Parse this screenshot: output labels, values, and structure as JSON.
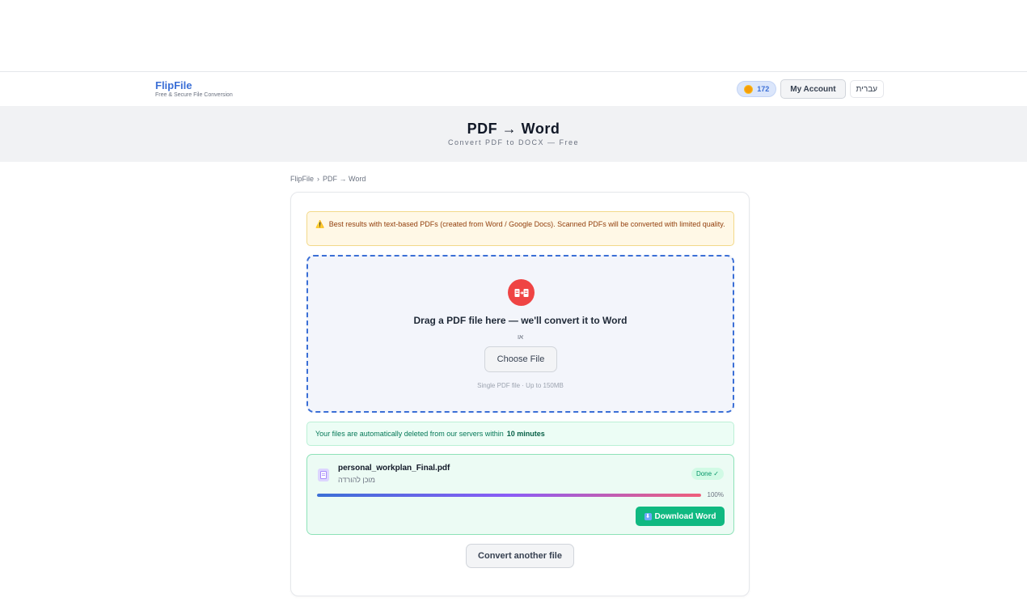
{
  "header": {
    "brand_name": "FlipFile",
    "brand_tagline": "Free & Secure File Conversion",
    "coins": "172",
    "account_label": "My Account",
    "language_label": "עברית"
  },
  "hero": {
    "title": "PDF → Word",
    "subtitle": "Convert PDF to DOCX — Free"
  },
  "breadcrumb": {
    "home": "FlipFile",
    "separator": "›",
    "current": "PDF → Word"
  },
  "notice": {
    "icon": "⚠️",
    "text": "Best results with text-based PDFs (created from Word / Google Docs). Scanned PDFs will be converted with limited quality."
  },
  "dropzone": {
    "icon": "pdf-to-word-icon",
    "title": "Drag a PDF file here — we'll convert it to Word",
    "or_text": "או",
    "choose_label": "Choose File",
    "hint": "Single PDF file · Up to 150MB"
  },
  "privacy": {
    "text": "Your files are automatically deleted from our servers within",
    "duration": "10 minutes"
  },
  "file": {
    "name": "personal_workplan_Final.pdf",
    "status": "מוכן להורדה",
    "badge": "Done ✓",
    "progress": 100,
    "progress_label": "100%",
    "download_label": "Download Word"
  },
  "actions": {
    "convert_another": "Convert another file"
  },
  "colors": {
    "brand": "#3b6fd6",
    "success": "#10b981",
    "danger": "#ef4444"
  }
}
